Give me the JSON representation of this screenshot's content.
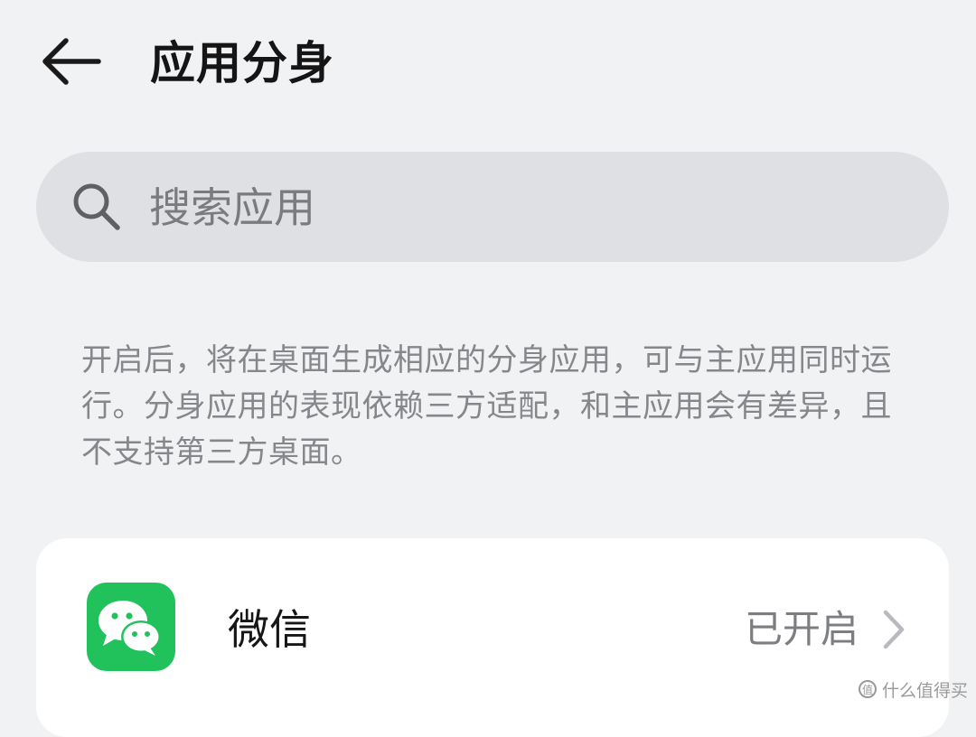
{
  "header": {
    "back_icon": "arrow-left-icon",
    "title": "应用分身"
  },
  "search": {
    "icon": "search-icon",
    "placeholder": "搜索应用",
    "value": ""
  },
  "description": "开启后，将在桌面生成相应的分身应用，可与主应用同时运行。分身应用的表现依赖三方适配，和主应用会有差异，且不支持第三方桌面。",
  "apps": [
    {
      "name": "微信",
      "status": "已开启",
      "icon": "wechat-icon",
      "icon_color": "#21c25c"
    }
  ],
  "watermark": {
    "badge": "值",
    "text": "什么值得买"
  },
  "colors": {
    "background": "#f1f2f4",
    "search_background": "#dfe0e3",
    "card_background": "#ffffff",
    "description_text": "#86878a"
  }
}
